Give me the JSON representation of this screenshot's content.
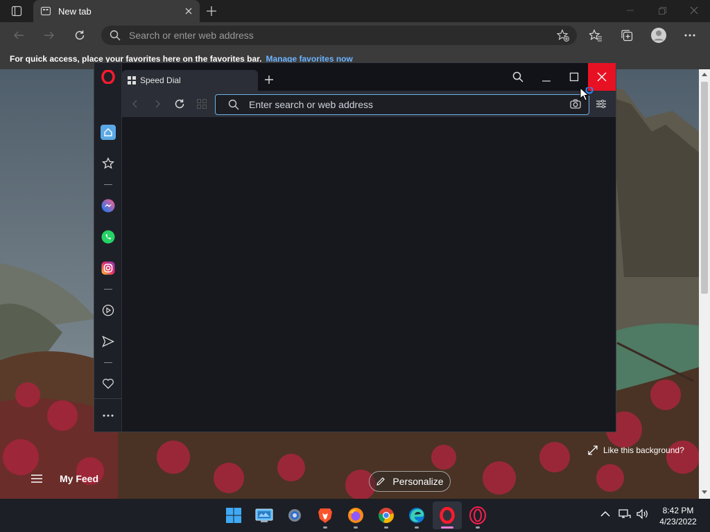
{
  "edge": {
    "tab_title": "New tab",
    "address_placeholder": "Search or enter web address",
    "favbar_text": "For quick access, place your favorites here on the favorites bar.",
    "favbar_link": "Manage favorites now",
    "myfeed_label": "My Feed",
    "personalize_label": "Personalize",
    "like_background": "Like this background?"
  },
  "opera": {
    "tab_title": "Speed Dial",
    "address_placeholder": "Enter search or web address",
    "sidebar_icons": [
      "home-icon",
      "bookmarks-icon",
      "messenger-icon",
      "whatsapp-icon",
      "instagram-icon",
      "player-icon",
      "flow-icon",
      "heart-icon",
      "more-icon"
    ]
  },
  "taskbar": {
    "time": "8:42 PM",
    "date": "4/23/2022",
    "apps": [
      "windows-start-icon",
      "control-panel-icon",
      "settings-icon",
      "brave-icon",
      "firefox-icon",
      "chrome-icon",
      "edge-icon",
      "opera-icon",
      "opera-gx-icon"
    ]
  },
  "colors": {
    "accent": "#6fb3e6",
    "close": "#e81123",
    "link": "#6cb4ff"
  }
}
